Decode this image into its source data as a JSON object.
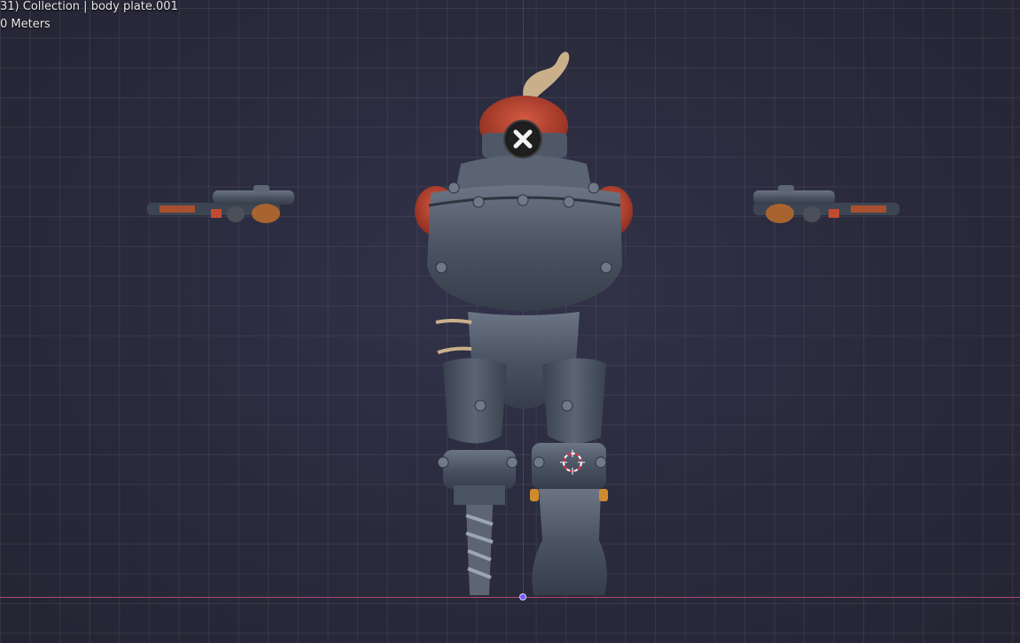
{
  "viewport": {
    "object_info": "31) Collection | body plate.001",
    "scale_info": "0 Meters"
  },
  "colors": {
    "background": "#2b2b3d",
    "grid_line": "#3a3a50",
    "x_axis": "#b04a6c",
    "origin": "#6a5cff",
    "armor": "#4f5a6b",
    "accent_red": "#c0432f"
  },
  "icons": {
    "close": "close-icon",
    "cursor": "3d-cursor-icon"
  }
}
